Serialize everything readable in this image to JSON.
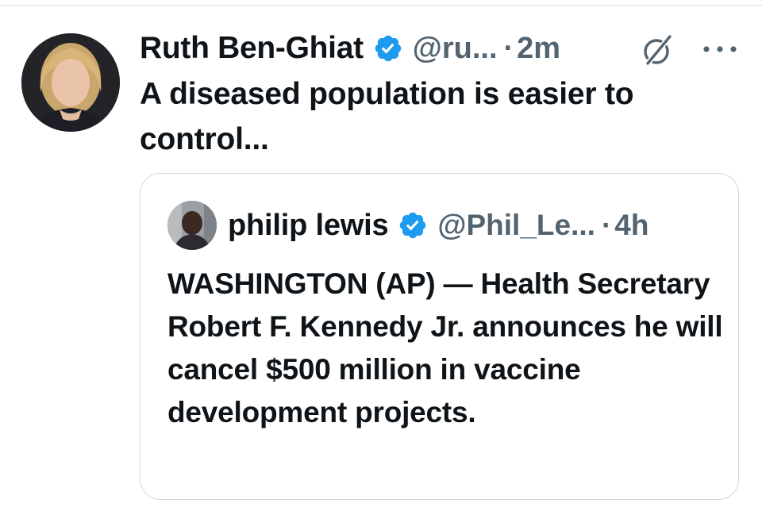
{
  "tweet": {
    "author_name": "Ruth Ben-Ghiat",
    "handle": "@ru...",
    "separator": "·",
    "time": "2m",
    "text": "A diseased population is easier to control..."
  },
  "quoted_tweet": {
    "author_name": "philip lewis",
    "handle": "@Phil_Le...",
    "separator": "·",
    "time": "4h",
    "text": "WASHINGTON (AP) — Health Secretary Robert F. Kennedy Jr. announces he will cancel $500 million in vaccine development projects."
  },
  "icons": {
    "verified": "verified-badge-icon",
    "grok": "grok-icon",
    "more": "more-options-icon"
  },
  "colors": {
    "verified_blue": "#1d9bf0",
    "text_primary": "#0f1419",
    "text_secondary": "#536471",
    "border": "#cfd9de"
  }
}
